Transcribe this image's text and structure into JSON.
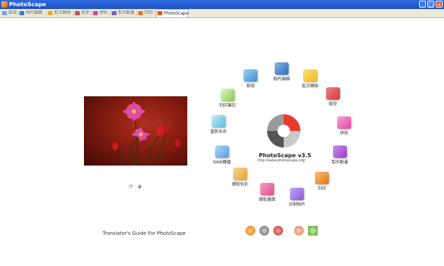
{
  "window": {
    "title": "PhotoScape",
    "minimize": "_",
    "maximize": "□",
    "close": "×"
  },
  "tabs": [
    {
      "label": "檢視",
      "color": "#7aa4d8"
    },
    {
      "label": "相片編輯",
      "color": "#3a78c8"
    },
    {
      "label": "批次轉換",
      "color": "#e0b030"
    },
    {
      "label": "版型",
      "color": "#d04a4a"
    },
    {
      "label": "拼貼",
      "color": "#cc4aa0"
    },
    {
      "label": "製作動畫",
      "color": "#7a60c0"
    },
    {
      "label": "列印",
      "color": "#d08030"
    },
    {
      "label": "PhotoScape",
      "color": "#e05a1c"
    }
  ],
  "left": {
    "guide_text": "Translator's Guide For PhotoScape"
  },
  "logo": {
    "name": "PhotoScape v3.5",
    "url": "http://www.photoscape.org/"
  },
  "menu": [
    {
      "label": "檢視",
      "color": "#3f8fd8",
      "icon": "viewer-icon"
    },
    {
      "label": "相片編輯",
      "color": "#2f6fb8",
      "icon": "editor-icon"
    },
    {
      "label": "批次轉換",
      "color": "#f0b820",
      "icon": "batch-editor-icon"
    },
    {
      "label": "版型",
      "color": "#d83838",
      "icon": "page-icon"
    },
    {
      "label": "拼貼",
      "color": "#e04aa0",
      "icon": "combine-icon"
    },
    {
      "label": "製作動畫",
      "color": "#9a3acc",
      "icon": "animated-gif-icon"
    },
    {
      "label": "列印",
      "color": "#e07818",
      "icon": "print-icon"
    },
    {
      "label": "分割相片",
      "color": "#8a58d8",
      "icon": "splitter-icon"
    },
    {
      "label": "擷取畫面",
      "color": "#e04890",
      "icon": "screen-capture-icon"
    },
    {
      "label": "擷取色彩",
      "color": "#e8a030",
      "icon": "color-picker-icon"
    },
    {
      "label": "RAW轉檔",
      "color": "#5a9ae0",
      "icon": "raw-converter-icon"
    },
    {
      "label": "重新命名",
      "color": "#58b8e0",
      "icon": "rename-icon"
    },
    {
      "label": "列印筆記",
      "color": "#88c848",
      "icon": "paper-print-icon"
    }
  ],
  "bottom_icons": [
    "help-icon",
    "tools-icon",
    "people-icon",
    "face-search-icon",
    "image-icon"
  ]
}
